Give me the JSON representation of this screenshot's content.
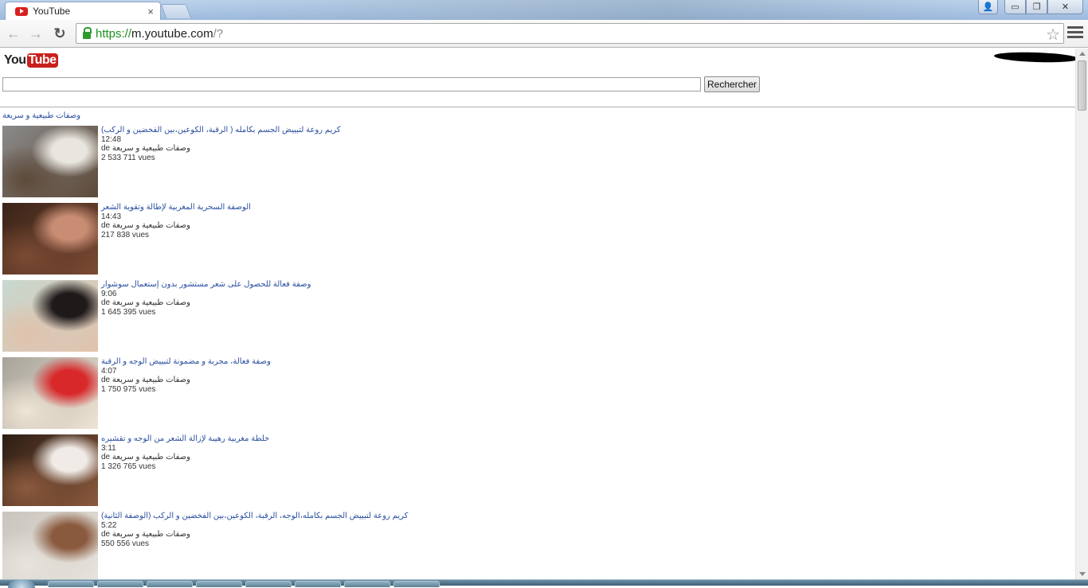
{
  "browser": {
    "tab_title": "YouTube",
    "tab_close": "×",
    "url_scheme": "https://",
    "url_host": "m.youtube.com",
    "url_path": "/?",
    "window_buttons": {
      "minimize": "▭",
      "maximize": "❐",
      "close": "✕",
      "profile": "👤"
    },
    "nav": {
      "back": "←",
      "forward": "→",
      "reload": "↻",
      "star": "☆"
    }
  },
  "logo": {
    "you": "You",
    "tube": "Tube"
  },
  "search": {
    "value": "",
    "button_label": "Rechercher"
  },
  "channel_heading": "وصفات طبيعية و سريعة",
  "videos": [
    {
      "title": "كريم روعة لتبييض الجسم بكامله ( الرقبة، الكوعين،بين الفخضين و الركب)",
      "duration": "12:48",
      "by": "de وصفات طبيعية و سريعة",
      "views": "2 533 711 vues",
      "thumb_colors": [
        "#8a8a8a",
        "#e9e6df",
        "#5d4a3a"
      ]
    },
    {
      "title": "الوصفة السحرية المغربية لإطالة وتقوية الشعر",
      "duration": "14:43",
      "by": "de وصفات طبيعية و سريعة",
      "views": "217 838 vues",
      "thumb_colors": [
        "#3a2418",
        "#c98d74",
        "#7b4a33"
      ]
    },
    {
      "title": "وصفة فعالة للحصول على شعر مستشور بدون إستعمال سوشوار",
      "duration": "9:06",
      "by": "de وصفات طبيعية و سريعة",
      "views": "1 645 395 vues",
      "thumb_colors": [
        "#c8d8d0",
        "#1f1a1a",
        "#e1c2ac"
      ]
    },
    {
      "title": "وصفة فعالة، مجربة و مضمونة لتبييض الوجه و الرقبة",
      "duration": "4:07",
      "by": "de وصفات طبيعية و سريعة",
      "views": "1 750 975 vues",
      "thumb_colors": [
        "#a6a39a",
        "#d8282a",
        "#efe4d5"
      ]
    },
    {
      "title": "خلطة مغربية رهيبة لإزالة الشعر من الوجه و تقشيره",
      "duration": "3:11",
      "by": "de وصفات طبيعية و سريعة",
      "views": "1 326 765 vues",
      "thumb_colors": [
        "#2b1d14",
        "#f0ebe6",
        "#8c5a3d"
      ]
    },
    {
      "title": "كريم روعة لتبييض الجسم بكامله،الوجه، الرقبة، الكوعين،بين الفخضين و الركب (الوصفة الثانية)",
      "duration": "5:22",
      "by": "de وصفات طبيعية و سريعة",
      "views": "550 556 vues",
      "thumb_colors": [
        "#c9c5be",
        "#8a5a3e",
        "#e8e4dd"
      ]
    }
  ]
}
